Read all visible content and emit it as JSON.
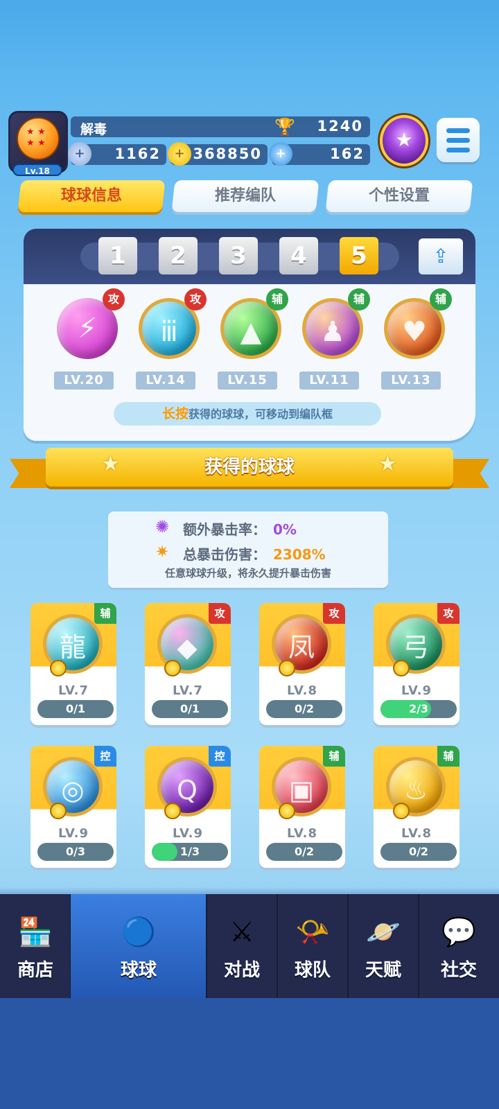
{
  "player": {
    "name": "解毒",
    "level": "Lv.18",
    "trophies": "1240"
  },
  "resources": [
    {
      "icon": "silver-coin-icon",
      "value": "1162"
    },
    {
      "icon": "gold-coin-icon",
      "value": "368850"
    },
    {
      "icon": "diamond-icon",
      "value": "162"
    }
  ],
  "tabs": [
    "球球信息",
    "推荐编队",
    "个性设置"
  ],
  "lineup": {
    "slots": [
      "1",
      "2",
      "3",
      "4",
      "5"
    ],
    "active_slot": "5",
    "balls": [
      {
        "role": "攻",
        "level": "LV.20",
        "colors": [
          "#ff9cf0",
          "#d23cd0"
        ],
        "glyph": "⚡"
      },
      {
        "role": "攻",
        "level": "LV.14",
        "colors": [
          "#9cf2ff",
          "#1aa8d8"
        ],
        "glyph": "ⅲ"
      },
      {
        "role": "辅",
        "level": "LV.15",
        "colors": [
          "#b6ff9c",
          "#28a846"
        ],
        "glyph": "▲"
      },
      {
        "role": "辅",
        "level": "LV.11",
        "colors": [
          "#ffd6a0",
          "#b043d8"
        ],
        "glyph": "♟"
      },
      {
        "role": "辅",
        "level": "LV.13",
        "colors": [
          "#ffd08a",
          "#e0551a"
        ],
        "glyph": "♥"
      }
    ],
    "hint_em": "长按",
    "hint_rest": "获得的球球，可移动到编队框"
  },
  "banner_title": "获得的球球",
  "crit": {
    "extra_label": "额外暴击率：",
    "extra_value": "0%",
    "total_label": "总暴击伤害：",
    "total_value": "2308%",
    "note": "任意球球升级，将永久提升暴击伤害"
  },
  "collection": [
    {
      "role": "辅",
      "level": "LV.7",
      "progress": "0/1",
      "fraction": 0,
      "colors": [
        "#bff7ff",
        "#1aa8b8"
      ],
      "glyph": "龍"
    },
    {
      "role": "攻",
      "level": "LV.7",
      "progress": "0/1",
      "fraction": 0,
      "colors": [
        "#ffb0f0",
        "#3cc0a8"
      ],
      "glyph": "◆"
    },
    {
      "role": "攻",
      "level": "LV.8",
      "progress": "0/2",
      "fraction": 0,
      "colors": [
        "#ffc080",
        "#c8201a"
      ],
      "glyph": "凤"
    },
    {
      "role": "攻",
      "level": "LV.9",
      "progress": "2/3",
      "fraction": 0.667,
      "colors": [
        "#9cf0c8",
        "#168a5a"
      ],
      "glyph": "弓"
    },
    {
      "role": "控",
      "level": "LV.9",
      "progress": "0/3",
      "fraction": 0,
      "colors": [
        "#b6f0ff",
        "#2a8ad8"
      ],
      "glyph": "◎"
    },
    {
      "role": "控",
      "level": "LV.9",
      "progress": "1/3",
      "fraction": 0.333,
      "colors": [
        "#e0a0ff",
        "#6a1aa8"
      ],
      "glyph": "Q"
    },
    {
      "role": "辅",
      "level": "LV.8",
      "progress": "0/2",
      "fraction": 0,
      "colors": [
        "#ffc0c8",
        "#e0384a"
      ],
      "glyph": "▣"
    },
    {
      "role": "辅",
      "level": "LV.8",
      "progress": "0/2",
      "fraction": 0,
      "colors": [
        "#fff08a",
        "#f0a000"
      ],
      "glyph": "♨"
    }
  ],
  "nav": [
    {
      "label": "商店",
      "icon": "shop-icon",
      "glyph": "🏪"
    },
    {
      "label": "球球",
      "icon": "balls-icon",
      "glyph": "🔵",
      "active": true
    },
    {
      "label": "对战",
      "icon": "crossed-swords-icon",
      "glyph": "⚔"
    },
    {
      "label": "球队",
      "icon": "whistle-icon",
      "glyph": "📯"
    },
    {
      "label": "天赋",
      "icon": "planet-icon",
      "glyph": "🪐"
    },
    {
      "label": "社交",
      "icon": "chat-heart-icon",
      "glyph": "💬"
    }
  ],
  "colors": {
    "attack": "#d9352f",
    "support": "#31a34a",
    "control": "#2a8ae6",
    "accent_gold": "#ffc512",
    "progress_fill": "#3fd37a"
  }
}
